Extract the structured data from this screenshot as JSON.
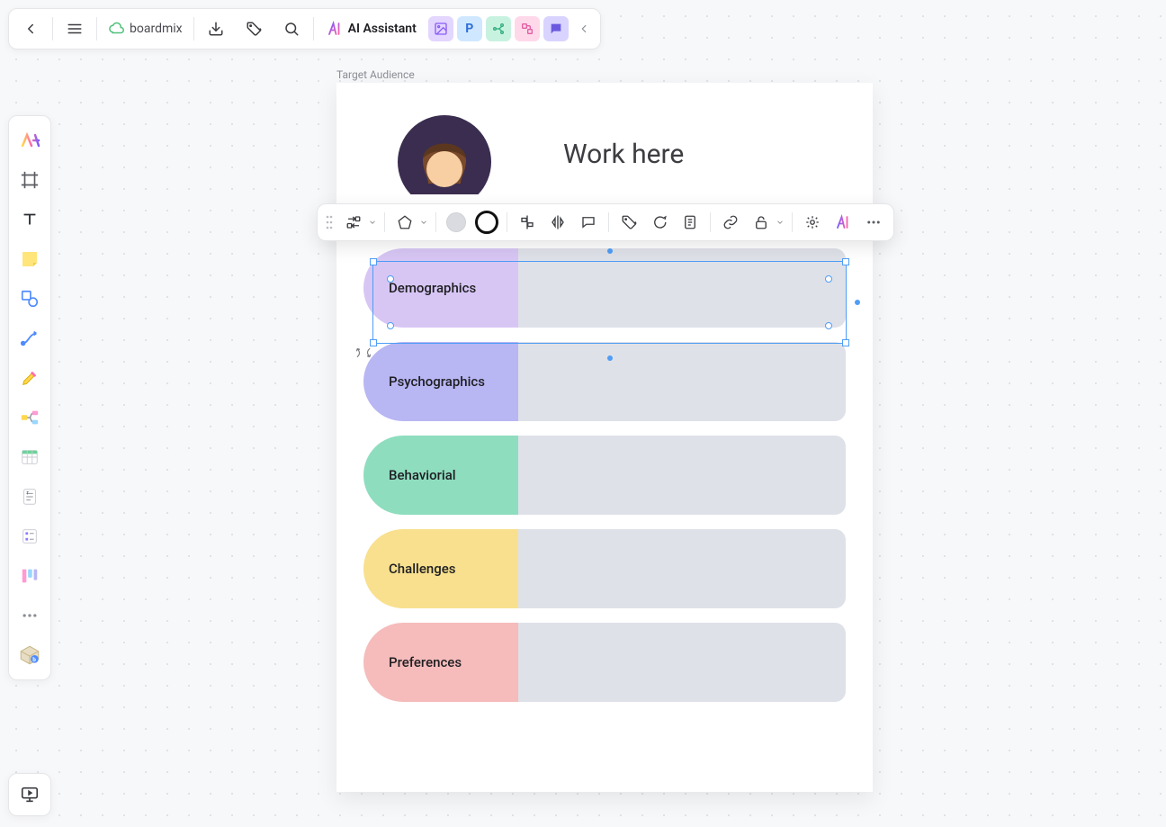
{
  "topbar": {
    "brand": "boardmix",
    "ai_label": "AI Assistant"
  },
  "frame": {
    "title_label": "Target Audience",
    "hero_title": "Work here"
  },
  "rows": [
    {
      "label": "Demographics",
      "color": "#d7c6f4"
    },
    {
      "label": "Psychographics",
      "color": "#b8b6f3"
    },
    {
      "label": "Behaviorial",
      "color": "#8eddbf"
    },
    {
      "label": "Challenges",
      "color": "#f8e08e"
    },
    {
      "label": "Preferences",
      "color": "#f5bcbb"
    }
  ],
  "selected_row_index": 0,
  "ai_chips": [
    {
      "name": "ai-image-icon",
      "bg": "#e3d6ff",
      "fg": "#8b5cf6",
      "glyph": "img"
    },
    {
      "name": "ai-ppt-icon",
      "bg": "#cfe8ff",
      "fg": "#2f6fd8",
      "glyph": "P"
    },
    {
      "name": "ai-mind-icon",
      "bg": "#c8f2e0",
      "fg": "#2fae7e",
      "glyph": "mind"
    },
    {
      "name": "ai-flow-icon",
      "bg": "#ffd9ea",
      "fg": "#e05da2",
      "glyph": "flow"
    },
    {
      "name": "ai-chat-icon",
      "bg": "#d8d4ff",
      "fg": "#6b5ae0",
      "glyph": "chat"
    }
  ]
}
